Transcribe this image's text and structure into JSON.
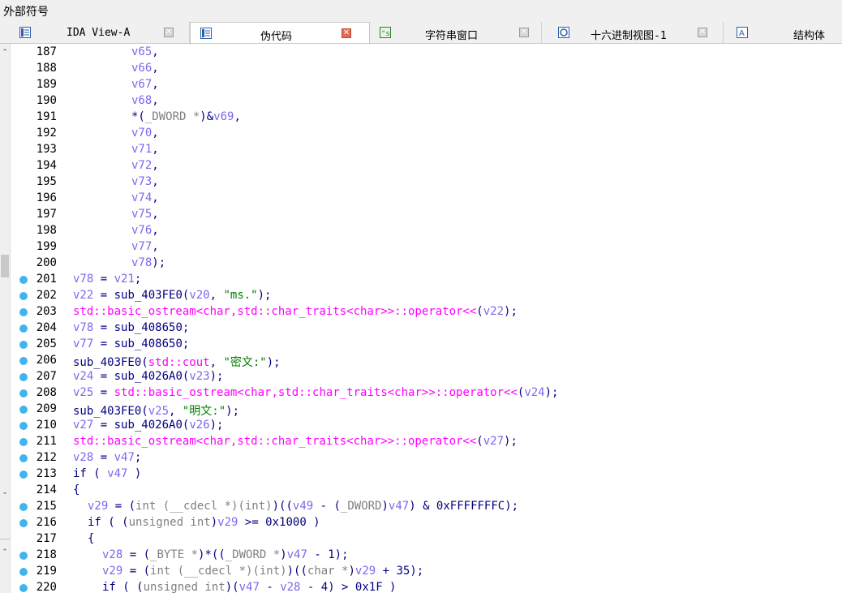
{
  "window": {
    "title": "外部符号"
  },
  "tabs": [
    {
      "label": "IDA View-A",
      "icon": "ida-view-icon",
      "active": false,
      "mono": true
    },
    {
      "label": "伪代码",
      "icon": "pseudocode-icon",
      "active": true,
      "mono": false
    },
    {
      "label": "字符串窗口",
      "icon": "strings-icon",
      "active": false,
      "mono": false
    },
    {
      "label": "十六进制视图-1",
      "icon": "hex-view-icon",
      "active": false,
      "mono": false
    },
    {
      "label": "结构体",
      "icon": "structures-icon",
      "active": false,
      "mono": false
    }
  ],
  "colors": {
    "variable": "#7b68ee",
    "keyword": "#000080",
    "library": "#ff00ff",
    "string": "#008000",
    "breakpoint_dot": "#3fb5ee"
  },
  "code_lines": [
    {
      "num": "187",
      "dot": false,
      "indent": 8,
      "tokens": [
        [
          "v",
          "v65"
        ],
        [
          "p",
          ","
        ]
      ]
    },
    {
      "num": "188",
      "dot": false,
      "indent": 8,
      "tokens": [
        [
          "v",
          "v66"
        ],
        [
          "p",
          ","
        ]
      ]
    },
    {
      "num": "189",
      "dot": false,
      "indent": 8,
      "tokens": [
        [
          "v",
          "v67"
        ],
        [
          "p",
          ","
        ]
      ]
    },
    {
      "num": "190",
      "dot": false,
      "indent": 8,
      "tokens": [
        [
          "v",
          "v68"
        ],
        [
          "p",
          ","
        ]
      ]
    },
    {
      "num": "191",
      "dot": false,
      "indent": 8,
      "tokens": [
        [
          "p",
          "*("
        ],
        [
          "c",
          "_DWORD *"
        ],
        [
          "p",
          ")&"
        ],
        [
          "v",
          "v69"
        ],
        [
          "p",
          ","
        ]
      ]
    },
    {
      "num": "192",
      "dot": false,
      "indent": 8,
      "tokens": [
        [
          "v",
          "v70"
        ],
        [
          "p",
          ","
        ]
      ]
    },
    {
      "num": "193",
      "dot": false,
      "indent": 8,
      "tokens": [
        [
          "v",
          "v71"
        ],
        [
          "p",
          ","
        ]
      ]
    },
    {
      "num": "194",
      "dot": false,
      "indent": 8,
      "tokens": [
        [
          "v",
          "v72"
        ],
        [
          "p",
          ","
        ]
      ]
    },
    {
      "num": "195",
      "dot": false,
      "indent": 8,
      "tokens": [
        [
          "v",
          "v73"
        ],
        [
          "p",
          ","
        ]
      ]
    },
    {
      "num": "196",
      "dot": false,
      "indent": 8,
      "tokens": [
        [
          "v",
          "v74"
        ],
        [
          "p",
          ","
        ]
      ]
    },
    {
      "num": "197",
      "dot": false,
      "indent": 8,
      "tokens": [
        [
          "v",
          "v75"
        ],
        [
          "p",
          ","
        ]
      ]
    },
    {
      "num": "198",
      "dot": false,
      "indent": 8,
      "tokens": [
        [
          "v",
          "v76"
        ],
        [
          "p",
          ","
        ]
      ]
    },
    {
      "num": "199",
      "dot": false,
      "indent": 8,
      "tokens": [
        [
          "v",
          "v77"
        ],
        [
          "p",
          ","
        ]
      ]
    },
    {
      "num": "200",
      "dot": false,
      "indent": 8,
      "tokens": [
        [
          "v",
          "v78"
        ],
        [
          "p",
          ");"
        ]
      ]
    },
    {
      "num": "201",
      "dot": true,
      "indent": 0,
      "tokens": [
        [
          "v",
          "v78"
        ],
        [
          "p",
          " = "
        ],
        [
          "v",
          "v21"
        ],
        [
          "p",
          ";"
        ]
      ]
    },
    {
      "num": "202",
      "dot": true,
      "indent": 0,
      "tokens": [
        [
          "v",
          "v22"
        ],
        [
          "p",
          " = sub_403FE0("
        ],
        [
          "v",
          "v20"
        ],
        [
          "p",
          ", "
        ],
        [
          "s",
          "\"ms.\""
        ],
        [
          "p",
          ");"
        ]
      ]
    },
    {
      "num": "203",
      "dot": true,
      "indent": 0,
      "tokens": [
        [
          "l",
          "std::basic_ostream<char,std::char_traits<char>>::operator<<"
        ],
        [
          "p",
          "("
        ],
        [
          "v",
          "v22"
        ],
        [
          "p",
          ");"
        ]
      ]
    },
    {
      "num": "204",
      "dot": true,
      "indent": 0,
      "tokens": [
        [
          "v",
          "v78"
        ],
        [
          "p",
          " = sub_408650;"
        ]
      ]
    },
    {
      "num": "205",
      "dot": true,
      "indent": 0,
      "tokens": [
        [
          "v",
          "v77"
        ],
        [
          "p",
          " = sub_408650;"
        ]
      ]
    },
    {
      "num": "206",
      "dot": true,
      "indent": 0,
      "tokens": [
        [
          "p",
          "sub_403FE0("
        ],
        [
          "l",
          "std::cout"
        ],
        [
          "p",
          ", "
        ],
        [
          "s",
          "\"密文:\""
        ],
        [
          "p",
          ");"
        ]
      ]
    },
    {
      "num": "207",
      "dot": true,
      "indent": 0,
      "tokens": [
        [
          "v",
          "v24"
        ],
        [
          "p",
          " = sub_4026A0("
        ],
        [
          "v",
          "v23"
        ],
        [
          "p",
          ");"
        ]
      ]
    },
    {
      "num": "208",
      "dot": true,
      "indent": 0,
      "tokens": [
        [
          "v",
          "v25"
        ],
        [
          "p",
          " = "
        ],
        [
          "l",
          "std::basic_ostream<char,std::char_traits<char>>::operator<<"
        ],
        [
          "p",
          "("
        ],
        [
          "v",
          "v24"
        ],
        [
          "p",
          ");"
        ]
      ]
    },
    {
      "num": "209",
      "dot": true,
      "indent": 0,
      "tokens": [
        [
          "p",
          "sub_403FE0("
        ],
        [
          "v",
          "v25"
        ],
        [
          "p",
          ", "
        ],
        [
          "s",
          "\"明文:\""
        ],
        [
          "p",
          ");"
        ]
      ]
    },
    {
      "num": "210",
      "dot": true,
      "indent": 0,
      "tokens": [
        [
          "v",
          "v27"
        ],
        [
          "p",
          " = sub_4026A0("
        ],
        [
          "v",
          "v26"
        ],
        [
          "p",
          ");"
        ]
      ]
    },
    {
      "num": "211",
      "dot": true,
      "indent": 0,
      "tokens": [
        [
          "l",
          "std::basic_ostream<char,std::char_traits<char>>::operator<<"
        ],
        [
          "p",
          "("
        ],
        [
          "v",
          "v27"
        ],
        [
          "p",
          ");"
        ]
      ]
    },
    {
      "num": "212",
      "dot": true,
      "indent": 0,
      "tokens": [
        [
          "v",
          "v28"
        ],
        [
          "p",
          " = "
        ],
        [
          "v",
          "v47"
        ],
        [
          "p",
          ";"
        ]
      ]
    },
    {
      "num": "213",
      "dot": true,
      "indent": 0,
      "tokens": [
        [
          "p",
          "if ( "
        ],
        [
          "v",
          "v47"
        ],
        [
          "p",
          " )"
        ]
      ]
    },
    {
      "num": "214",
      "dot": false,
      "indent": 0,
      "tokens": [
        [
          "p",
          "{"
        ]
      ]
    },
    {
      "num": "215",
      "dot": true,
      "indent": 2,
      "tokens": [
        [
          "v",
          "v29"
        ],
        [
          "p",
          " = ("
        ],
        [
          "c",
          "int (__cdecl *)(int)"
        ],
        [
          "p",
          ")(("
        ],
        [
          "v",
          "v49"
        ],
        [
          "p",
          " - ("
        ],
        [
          "c",
          "_DWORD"
        ],
        [
          "p",
          ")"
        ],
        [
          "v",
          "v47"
        ],
        [
          "p",
          ") & 0xFFFFFFFC);"
        ]
      ]
    },
    {
      "num": "216",
      "dot": true,
      "indent": 2,
      "tokens": [
        [
          "p",
          "if ( ("
        ],
        [
          "c",
          "unsigned int"
        ],
        [
          "p",
          ")"
        ],
        [
          "v",
          "v29"
        ],
        [
          "p",
          " >= 0x1000 )"
        ]
      ]
    },
    {
      "num": "217",
      "dot": false,
      "indent": 2,
      "tokens": [
        [
          "p",
          "{"
        ]
      ]
    },
    {
      "num": "218",
      "dot": true,
      "indent": 4,
      "tokens": [
        [
          "v",
          "v28"
        ],
        [
          "p",
          " = ("
        ],
        [
          "c",
          "_BYTE *"
        ],
        [
          "p",
          ")*(("
        ],
        [
          "c",
          "_DWORD *"
        ],
        [
          "p",
          ")"
        ],
        [
          "v",
          "v47"
        ],
        [
          "p",
          " - 1);"
        ]
      ]
    },
    {
      "num": "219",
      "dot": true,
      "indent": 4,
      "tokens": [
        [
          "v",
          "v29"
        ],
        [
          "p",
          " = ("
        ],
        [
          "c",
          "int (__cdecl *)(int)"
        ],
        [
          "p",
          ")(("
        ],
        [
          "c",
          "char *"
        ],
        [
          "p",
          ")"
        ],
        [
          "v",
          "v29"
        ],
        [
          "p",
          " + 35);"
        ]
      ]
    },
    {
      "num": "220",
      "dot": true,
      "indent": 4,
      "tokens": [
        [
          "p",
          "if ( ("
        ],
        [
          "c",
          "unsigned int"
        ],
        [
          "p",
          ")("
        ],
        [
          "v",
          "v47"
        ],
        [
          "p",
          " - "
        ],
        [
          "v",
          "v28"
        ],
        [
          "p",
          " - 4) > 0x1F )"
        ]
      ]
    }
  ]
}
